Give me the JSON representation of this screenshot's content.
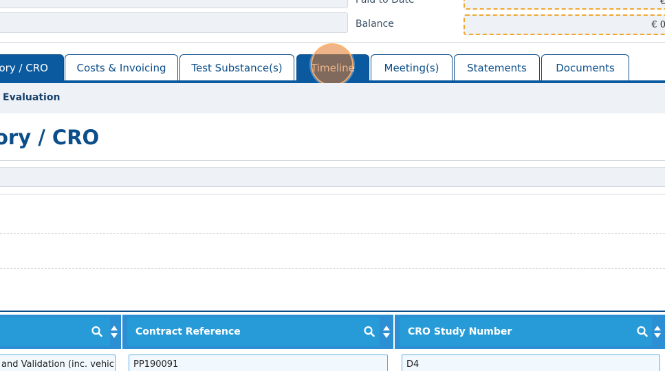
{
  "header": {
    "paid_to_date_label": "Paid to Date",
    "paid_to_date_value": "€",
    "balance_label": "Balance",
    "balance_value": "€ 0"
  },
  "tabs": [
    {
      "label": "Laboratory / CRO",
      "visible": "tory / CRO",
      "active": true
    },
    {
      "label": "Costs & Invoicing",
      "active": false
    },
    {
      "label": "Test Substance(s)",
      "active": false
    },
    {
      "label": "Timeline",
      "active": true
    },
    {
      "label": "Meeting(s)",
      "active": false
    },
    {
      "label": "Statements",
      "active": false
    },
    {
      "label": "Documents",
      "active": false
    }
  ],
  "subnav": {
    "item": "Evaluation"
  },
  "section": {
    "title": "ory / CRO"
  },
  "grid": {
    "columns": [
      {
        "header": ""
      },
      {
        "header": "Contract Reference"
      },
      {
        "header": "CRO Study Number"
      }
    ],
    "rows": [
      [
        "and Validation (inc. vehicl",
        "PP190091",
        "D4"
      ]
    ]
  },
  "colors": {
    "primary": "#0b5aa0",
    "header_blue": "#279bd8",
    "highlight_orange": "#f0a830"
  }
}
